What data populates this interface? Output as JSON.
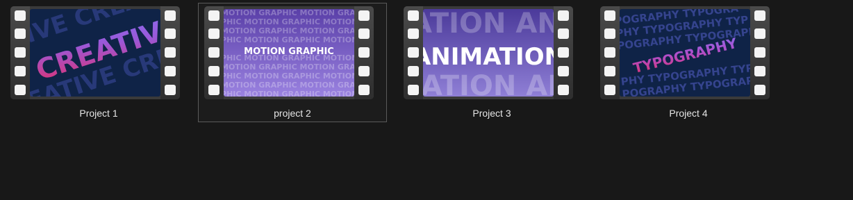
{
  "projects": [
    {
      "title": "Project 1",
      "thumb_text": "CREATIVE",
      "selected": false
    },
    {
      "title": "project 2",
      "thumb_text": "MOTION GRAPHIC",
      "selected": true
    },
    {
      "title": "Project 3",
      "thumb_text": "ANIMATION",
      "selected": false
    },
    {
      "title": "Project 4",
      "thumb_text": "TYPOGRAPHY",
      "selected": false
    }
  ],
  "colors": {
    "background": "#181818",
    "caption": "#e6e6e6",
    "selection_border": "#5a5a5a",
    "film_frame": "#3a3a3a",
    "accent_pink": "#e0306e",
    "accent_purple": "#8a6cf0",
    "thumb_navy": "#0f2347"
  }
}
